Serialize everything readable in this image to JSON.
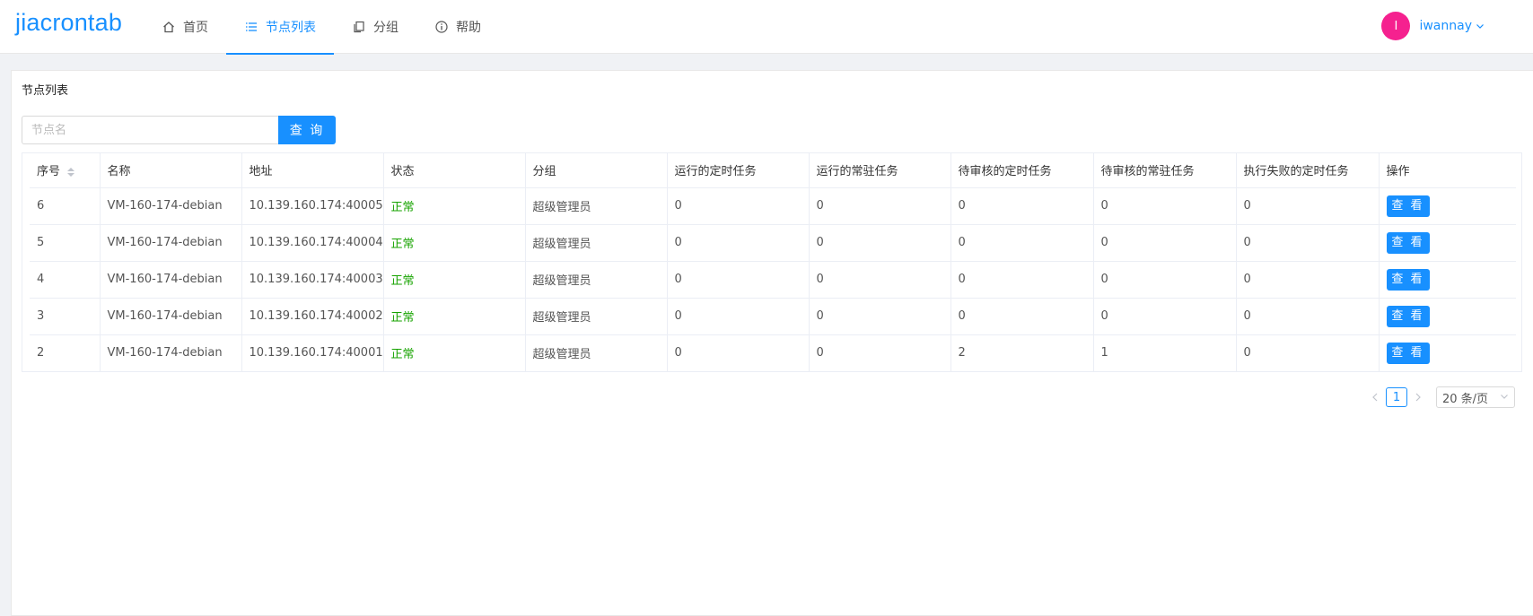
{
  "app": {
    "logo": "jiacrontab"
  },
  "nav": [
    {
      "label": "首页",
      "icon": "home-icon",
      "active": false
    },
    {
      "label": "节点列表",
      "icon": "list-icon",
      "active": true
    },
    {
      "label": "分组",
      "icon": "copy-icon",
      "active": false
    },
    {
      "label": "帮助",
      "icon": "info-icon",
      "active": false
    }
  ],
  "user": {
    "avatar_letter": "I",
    "name": "iwannay",
    "avatar_color": "#f5218f"
  },
  "page": {
    "title": "节点列表"
  },
  "search": {
    "placeholder": "节点名",
    "value": "",
    "button_label": "查 询"
  },
  "table": {
    "headers": [
      "序号",
      "名称",
      "地址",
      "状态",
      "分组",
      "运行的定时任务",
      "运行的常驻任务",
      "待审核的定时任务",
      "待审核的常驻任务",
      "执行失败的定时任务",
      "操作"
    ],
    "action_label": "查 看",
    "rows": [
      [
        "6",
        "VM-160-174-debian",
        "10.139.160.174:40005",
        "正常",
        "超级管理员",
        "0",
        "0",
        "0",
        "0",
        "0"
      ],
      [
        "5",
        "VM-160-174-debian",
        "10.139.160.174:40004",
        "正常",
        "超级管理员",
        "0",
        "0",
        "0",
        "0",
        "0"
      ],
      [
        "4",
        "VM-160-174-debian",
        "10.139.160.174:40003",
        "正常",
        "超级管理员",
        "0",
        "0",
        "0",
        "0",
        "0"
      ],
      [
        "3",
        "VM-160-174-debian",
        "10.139.160.174:40002",
        "正常",
        "超级管理员",
        "0",
        "0",
        "0",
        "0",
        "0"
      ],
      [
        "2",
        "VM-160-174-debian",
        "10.139.160.174:40001",
        "正常",
        "超级管理员",
        "0",
        "0",
        "2",
        "1",
        "0"
      ]
    ]
  },
  "pagination": {
    "current": "1",
    "page_size": "20 条/页"
  },
  "colors": {
    "accent": "#1890ff",
    "status_ok": "#17a300"
  }
}
